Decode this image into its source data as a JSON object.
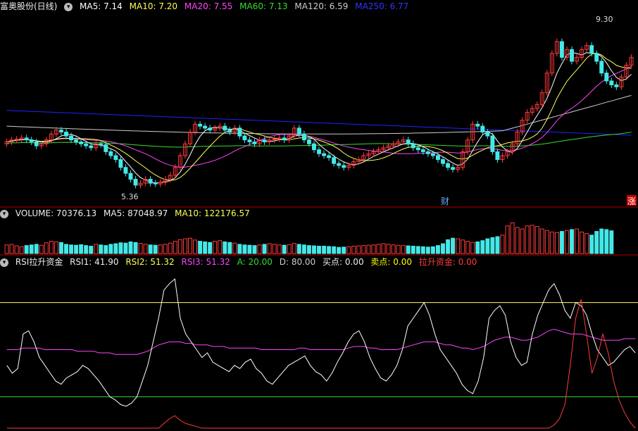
{
  "colors": {
    "up": "#ff3b3b",
    "down": "#44e8e8",
    "ma5": "#ffffff",
    "ma10": "#ffff55",
    "ma20": "#ff44ff",
    "ma60": "#33dd33",
    "ma120": "#cccccc",
    "ma250": "#2222ff",
    "separator": "#b00000"
  },
  "header_main": {
    "title": "富奥股份(日线)",
    "toggle_icon": "chevron-down-icon",
    "ma5_label": "MA5: 7.14",
    "ma10_label": "MA10: 7.20",
    "ma20_label": "MA20: 7.55",
    "ma60_label": "MA60: 7.13",
    "ma120_label": "MA120: 6.59",
    "ma250_label": "MA250: 6.77"
  },
  "header_volume": {
    "volume_label": "VOLUME: 70376.13",
    "ma5_label": "MA5: 87048.97",
    "ma10_label": "MA10: 122176.57"
  },
  "header_rsi": {
    "name": "RSI拉升资金",
    "rsi1_label": "RSI1: 41.90",
    "rsi2_label": "RSI2: 51.32",
    "rsi3_label": "RSI3: 51.32",
    "a_label": "A: 20.00",
    "d_label": "D: 80.00",
    "buy_label": "买点: 0.00",
    "sell_label": "卖点: 0.00",
    "fund_label": "拉升资金: 0.00"
  },
  "chart_data": {
    "type": "candlestick",
    "annotations": {
      "high": "9.30",
      "low": "5.36",
      "marker_cai": "财",
      "marker_zhang": "涨"
    },
    "price_range": [
      5.0,
      9.8
    ],
    "closes": [
      6.55,
      6.6,
      6.62,
      6.65,
      6.6,
      6.55,
      6.45,
      6.5,
      6.6,
      6.75,
      6.85,
      6.8,
      6.7,
      6.6,
      6.55,
      6.5,
      6.45,
      6.4,
      6.5,
      6.48,
      6.3,
      6.2,
      6.1,
      5.9,
      5.75,
      5.6,
      5.45,
      5.5,
      5.6,
      5.5,
      5.48,
      5.52,
      5.6,
      5.7,
      5.9,
      6.2,
      6.5,
      6.8,
      7.0,
      6.95,
      6.9,
      6.85,
      6.9,
      6.95,
      6.85,
      6.8,
      6.9,
      6.7,
      6.6,
      6.55,
      6.5,
      6.6,
      6.55,
      6.6,
      6.62,
      6.65,
      6.6,
      6.7,
      6.9,
      6.75,
      6.6,
      6.5,
      6.35,
      6.25,
      6.2,
      6.15,
      6.0,
      5.95,
      5.9,
      5.95,
      6.05,
      6.1,
      6.2,
      6.25,
      6.3,
      6.35,
      6.4,
      6.45,
      6.5,
      6.55,
      6.6,
      6.5,
      6.4,
      6.35,
      6.3,
      6.25,
      6.2,
      6.1,
      6.0,
      5.9,
      5.85,
      5.9,
      6.3,
      6.6,
      7.0,
      6.95,
      6.8,
      6.7,
      6.3,
      6.1,
      6.2,
      6.3,
      6.5,
      6.8,
      7.1,
      7.3,
      7.4,
      7.5,
      7.8,
      8.3,
      8.8,
      9.1,
      8.7,
      8.9,
      8.6,
      8.7,
      8.9,
      9.0,
      8.8,
      8.6,
      8.3,
      8.1,
      8.0,
      7.95,
      8.2,
      8.5,
      8.7
    ],
    "volumes": [
      28,
      30,
      25,
      22,
      26,
      28,
      30,
      27,
      35,
      40,
      38,
      36,
      30,
      28,
      27,
      29,
      26,
      24,
      30,
      28,
      26,
      30,
      32,
      35,
      34,
      38,
      36,
      33,
      30,
      28,
      27,
      28,
      30,
      34,
      40,
      45,
      48,
      50,
      44,
      40,
      38,
      36,
      40,
      42,
      38,
      36,
      34,
      30,
      28,
      27,
      26,
      28,
      30,
      32,
      30,
      28,
      27,
      29,
      33,
      30,
      28,
      26,
      25,
      24,
      24,
      23,
      22,
      20,
      21,
      22,
      24,
      25,
      26,
      27,
      28,
      30,
      32,
      30,
      28,
      27,
      26,
      25,
      24,
      23,
      22,
      21,
      22,
      26,
      32,
      45,
      50,
      48,
      44,
      40,
      36,
      38,
      42,
      48,
      52,
      55,
      60,
      90,
      100,
      85,
      80,
      90,
      92,
      88,
      80,
      75,
      70,
      68,
      72,
      75,
      78,
      80,
      70,
      65,
      60,
      72,
      80,
      78,
      74
    ],
    "volume_range": [
      0,
      110000
    ],
    "rsi_range": [
      0,
      100
    ],
    "rsi_levels": {
      "A": 20,
      "D": 80
    },
    "rsi1": [
      40,
      35,
      38,
      60,
      62,
      55,
      45,
      40,
      35,
      30,
      28,
      32,
      34,
      36,
      40,
      38,
      34,
      30,
      25,
      20,
      18,
      15,
      14,
      16,
      20,
      30,
      40,
      55,
      70,
      88,
      92,
      95,
      70,
      60,
      55,
      50,
      45,
      48,
      42,
      40,
      38,
      36,
      40,
      38,
      42,
      44,
      38,
      35,
      30,
      28,
      32,
      36,
      40,
      42,
      44,
      46,
      40,
      36,
      34,
      30,
      35,
      42,
      48,
      55,
      60,
      62,
      55,
      45,
      38,
      32,
      30,
      34,
      40,
      50,
      65,
      70,
      75,
      80,
      72,
      60,
      50,
      45,
      40,
      35,
      28,
      24,
      22,
      30,
      45,
      70,
      75,
      78,
      72,
      55,
      45,
      40,
      42,
      60,
      72,
      80,
      88,
      92,
      85,
      75,
      70,
      80,
      78,
      72,
      60,
      50,
      45,
      40,
      42,
      46,
      50,
      52,
      48
    ],
    "rsi2": [
      50,
      50,
      50,
      51,
      51,
      51,
      51,
      50,
      50,
      50,
      50,
      50,
      50,
      49,
      49,
      49,
      49,
      48,
      48,
      48,
      47,
      47,
      47,
      47,
      47,
      48,
      49,
      51,
      53,
      54,
      55,
      55,
      55,
      54,
      54,
      53,
      53,
      53,
      52,
      52,
      52,
      51,
      51,
      51,
      51,
      51,
      51,
      50,
      50,
      50,
      50,
      50,
      50,
      50,
      51,
      51,
      50,
      50,
      50,
      50,
      50,
      50,
      50,
      51,
      52,
      52,
      52,
      51,
      51,
      50,
      50,
      50,
      50,
      51,
      52,
      53,
      54,
      55,
      55,
      55,
      54,
      53,
      53,
      52,
      51,
      51,
      50,
      51,
      52,
      54,
      56,
      57,
      58,
      58,
      57,
      56,
      56,
      57,
      58,
      60,
      62,
      63,
      62,
      61,
      60,
      60,
      60,
      59,
      58,
      57,
      56,
      56,
      56,
      56,
      57,
      57,
      57
    ],
    "fund": [
      0,
      0,
      0,
      0,
      0,
      0,
      0,
      0,
      0,
      0,
      0,
      0,
      0,
      0,
      0,
      0,
      0,
      0,
      0,
      0,
      0,
      0,
      0,
      0,
      0,
      0,
      0,
      0,
      0,
      3,
      6,
      8,
      5,
      3,
      2,
      1,
      0,
      0,
      0,
      0,
      0,
      0,
      0,
      0,
      0,
      0,
      0,
      0,
      0,
      0,
      0,
      0,
      0,
      0,
      0,
      0,
      0,
      0,
      0,
      0,
      0,
      0,
      0,
      0,
      0,
      0,
      0,
      0,
      0,
      0,
      0,
      0,
      0,
      0,
      0,
      0,
      0,
      0,
      0,
      0,
      0,
      0,
      0,
      0,
      0,
      0,
      0,
      0,
      0,
      0,
      0,
      0,
      0,
      0,
      0,
      0,
      0,
      0,
      0,
      0,
      0,
      2,
      6,
      15,
      40,
      70,
      82,
      60,
      35,
      45,
      60,
      48,
      30,
      18,
      10,
      4,
      0
    ]
  }
}
